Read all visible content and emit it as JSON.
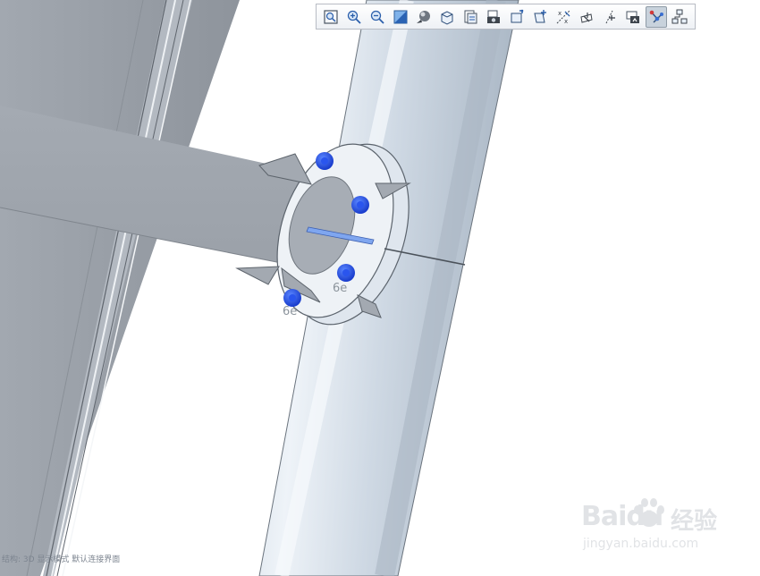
{
  "toolbar": {
    "buttons": [
      {
        "name": "refit-view",
        "icon": "zoom-fit-icon"
      },
      {
        "name": "zoom-in",
        "icon": "zoom-in-icon"
      },
      {
        "name": "zoom-out",
        "icon": "zoom-out-icon"
      },
      {
        "name": "repaint",
        "icon": "repaint-icon"
      },
      {
        "name": "display-style",
        "icon": "shading-sphere-icon"
      },
      {
        "name": "saved-orientations",
        "icon": "cube-orientation-icon"
      },
      {
        "name": "view-manager",
        "icon": "view-manager-icon"
      },
      {
        "name": "appearance",
        "icon": "camera-icon"
      },
      {
        "name": "datum-planes",
        "icon": "datum-plane-icon"
      },
      {
        "name": "datum-axes",
        "icon": "datum-axis-icon"
      },
      {
        "name": "datum-points",
        "icon": "datum-point-icon"
      },
      {
        "name": "coordinate-systems",
        "icon": "csys-icon"
      },
      {
        "name": "annotation-display",
        "icon": "annotation-icon"
      },
      {
        "name": "spin-center",
        "icon": "spin-center-icon"
      },
      {
        "name": "connection-display",
        "icon": "connection-icon",
        "active": true
      },
      {
        "name": "structure-tree",
        "icon": "tree-structure-icon"
      }
    ]
  },
  "status_bar": {
    "text": "结构: 3D 显示模式 默认连接界面"
  },
  "watermark": {
    "brand": "Baidu",
    "cn": "经验",
    "url": "jingyan.baidu.com"
  },
  "model": {
    "member_label_1": "6e",
    "member_label_2": "6e"
  },
  "colors": {
    "steel": "#9ea4ac",
    "steel_dark": "#7e858e",
    "pipe_light": "#dde6f0",
    "pipe_shadow": "#b4c1cf",
    "bolt_blue": "#1f4fe0",
    "toolbar_bg": "#f2f4f7",
    "active_button": "#c8d2dc"
  }
}
